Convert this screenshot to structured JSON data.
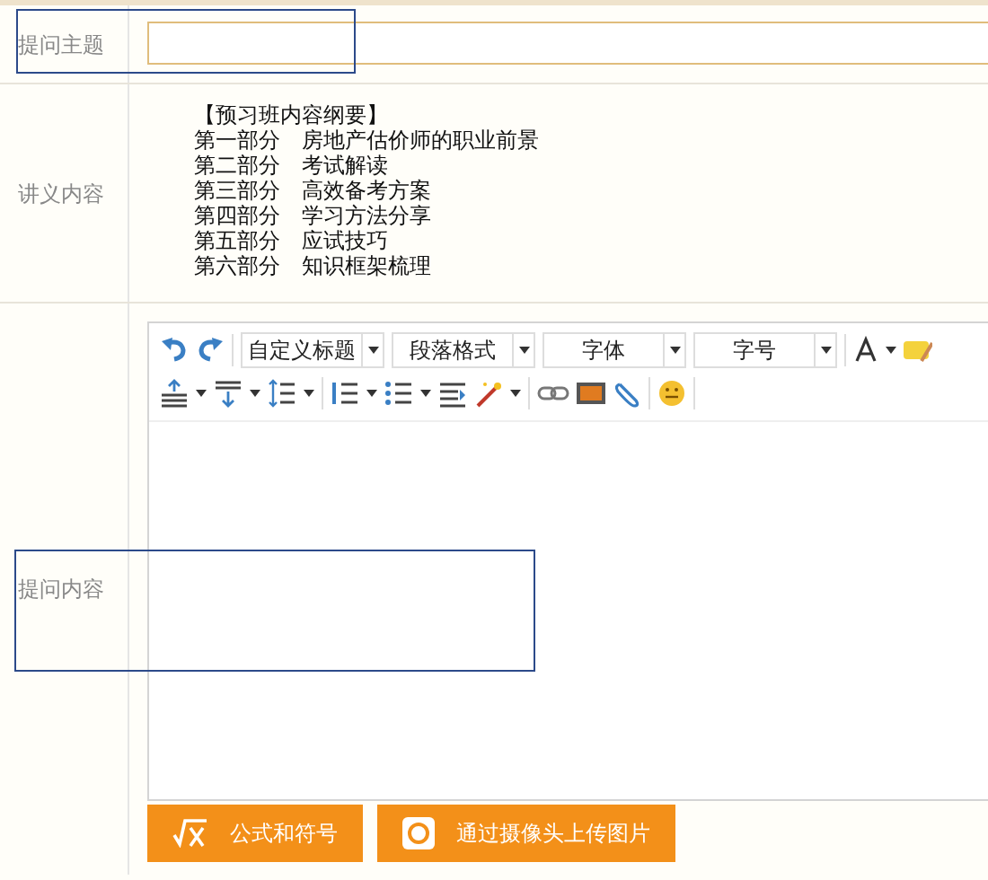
{
  "subject_row": {
    "label": "提问主题"
  },
  "lecture_row": {
    "label": "讲义内容",
    "lines": [
      "【预习班内容纲要】",
      "第一部分　房地产估价师的职业前景",
      "第二部分　考试解读",
      "第三部分　高效备考方案",
      "第四部分　学习方法分享",
      "第五部分　应试技巧",
      "第六部分　知识框架梳理"
    ]
  },
  "question_row": {
    "label": "提问内容",
    "toolbar_selects": [
      "自定义标题",
      "段落格式",
      "字体",
      "字号"
    ],
    "buttons": [
      {
        "kind": "formula",
        "label": "公式和符号"
      },
      {
        "kind": "camera",
        "label": "通过摄像头上传图片"
      }
    ]
  }
}
